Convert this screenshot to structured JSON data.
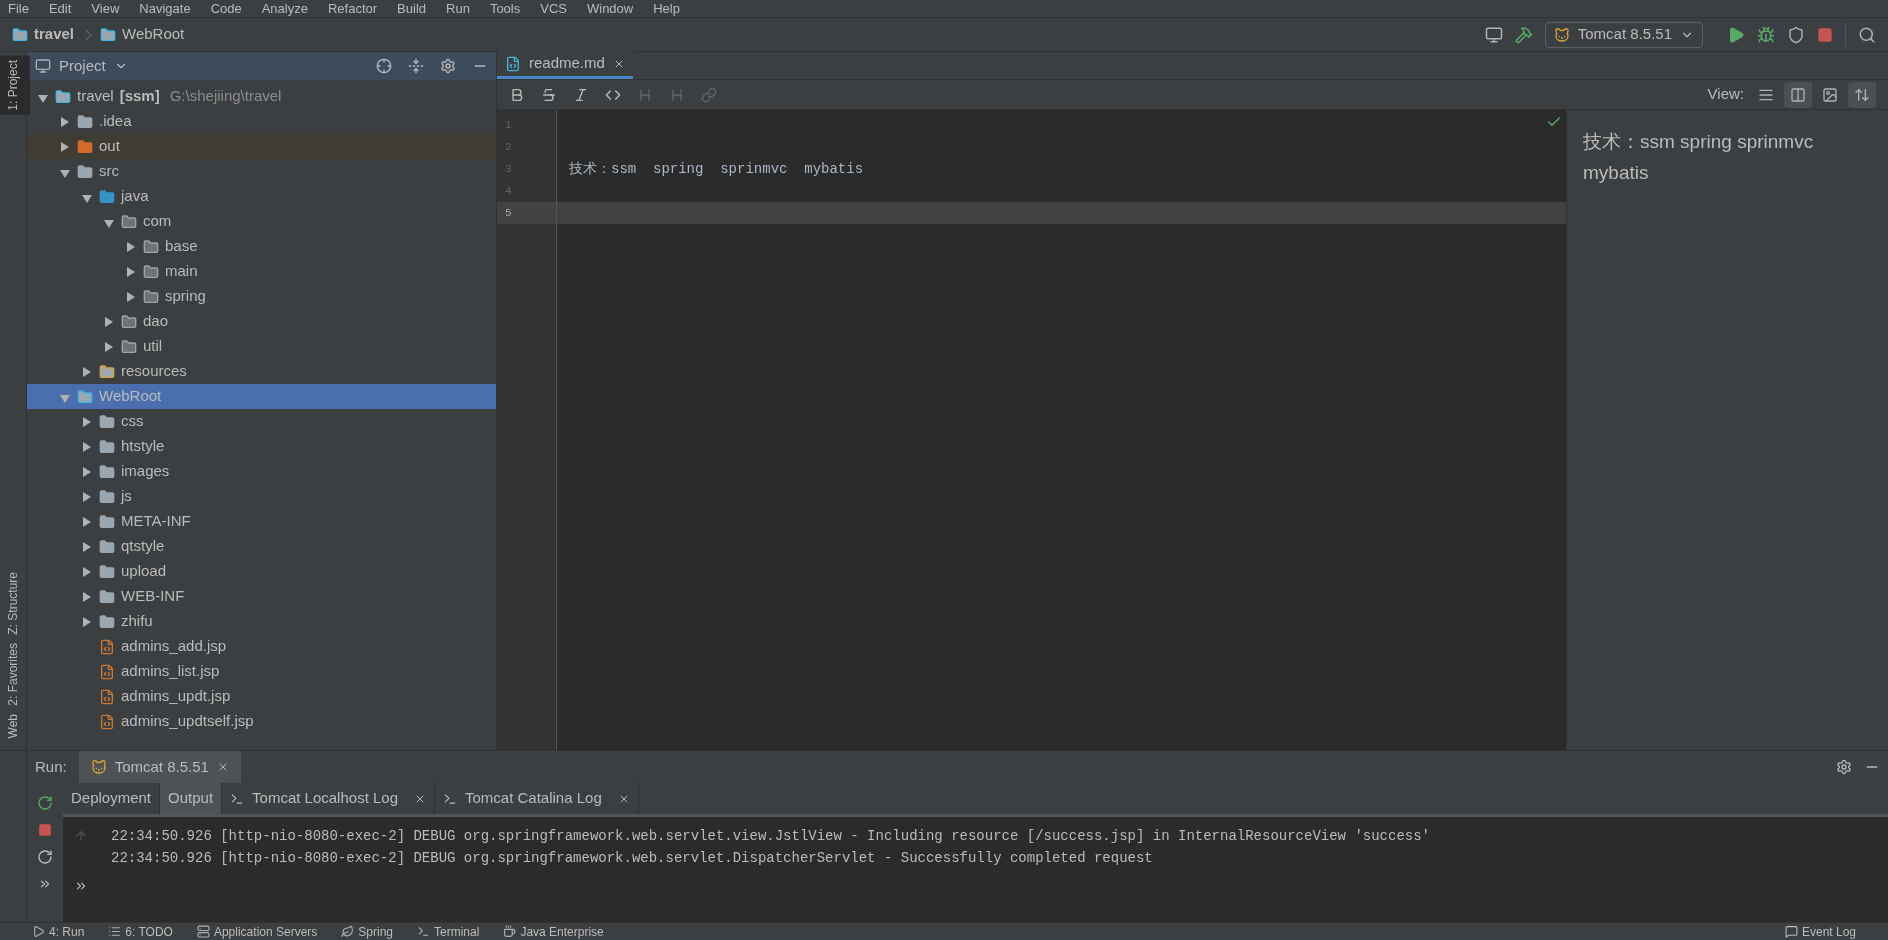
{
  "menu": [
    "File",
    "Edit",
    "View",
    "Navigate",
    "Code",
    "Analyze",
    "Refactor",
    "Build",
    "Run",
    "Tools",
    "VCS",
    "Window",
    "Help"
  ],
  "breadcrumbs": [
    {
      "label": "travel",
      "kind": "project"
    },
    {
      "label": "WebRoot",
      "kind": "web"
    }
  ],
  "run_config": {
    "label": "Tomcat 8.5.51"
  },
  "side_tabs_top": [
    {
      "label": "1: Project",
      "selected": true
    }
  ],
  "side_tabs_bottom": [
    {
      "label": "Z: Structure",
      "selected": false
    },
    {
      "label": "2: Favorites",
      "selected": false
    },
    {
      "label": "Web",
      "selected": false
    }
  ],
  "project_panel": {
    "title": "Project"
  },
  "tree": [
    {
      "name": "travel",
      "tag": "[ssm]",
      "path": "G:\\shejiing\\travel",
      "kind": "module",
      "expanded": true,
      "selected": false,
      "children": [
        {
          "name": ".idea",
          "kind": "folder",
          "expanded": false,
          "selected": false
        },
        {
          "name": "out",
          "kind": "excluded",
          "expanded": false,
          "selected": false
        },
        {
          "name": "src",
          "kind": "folder",
          "expanded": true,
          "selected": false,
          "children": [
            {
              "name": "java",
              "kind": "source",
              "expanded": true,
              "selected": false,
              "children": [
                {
                  "name": "com",
                  "kind": "package",
                  "expanded": true,
                  "selected": false,
                  "children": [
                    {
                      "name": "base",
                      "kind": "package",
                      "expanded": false,
                      "selected": false
                    },
                    {
                      "name": "main",
                      "kind": "package",
                      "expanded": false,
                      "selected": false
                    },
                    {
                      "name": "spring",
                      "kind": "package",
                      "expanded": false,
                      "selected": false
                    }
                  ]
                },
                {
                  "name": "dao",
                  "kind": "package",
                  "expanded": false,
                  "selected": false
                },
                {
                  "name": "util",
                  "kind": "package",
                  "expanded": false,
                  "selected": false
                }
              ]
            },
            {
              "name": "resources",
              "kind": "resources",
              "expanded": false,
              "selected": false
            }
          ]
        },
        {
          "name": "WebRoot",
          "kind": "web",
          "expanded": true,
          "selected": true,
          "children": [
            {
              "name": "css",
              "kind": "folder",
              "expanded": false,
              "selected": false
            },
            {
              "name": "htstyle",
              "kind": "folder",
              "expanded": false,
              "selected": false
            },
            {
              "name": "images",
              "kind": "folder",
              "expanded": false,
              "selected": false
            },
            {
              "name": "js",
              "kind": "folder",
              "expanded": false,
              "selected": false
            },
            {
              "name": "META-INF",
              "kind": "folder",
              "expanded": false,
              "selected": false
            },
            {
              "name": "qtstyle",
              "kind": "folder",
              "expanded": false,
              "selected": false
            },
            {
              "name": "upload",
              "kind": "folder",
              "expanded": false,
              "selected": false
            },
            {
              "name": "WEB-INF",
              "kind": "folder",
              "expanded": false,
              "selected": false
            },
            {
              "name": "zhifu",
              "kind": "folder",
              "expanded": false,
              "selected": false
            },
            {
              "name": "admins_add.jsp",
              "kind": "jsp",
              "selected": false
            },
            {
              "name": "admins_list.jsp",
              "kind": "jsp",
              "selected": false
            },
            {
              "name": "admins_updt.jsp",
              "kind": "jsp",
              "selected": false
            },
            {
              "name": "admins_updtself.jsp",
              "kind": "jsp",
              "selected": false
            }
          ]
        }
      ]
    }
  ],
  "editor": {
    "tab": "readme.md",
    "view_label": "View:",
    "view_modes": [
      {
        "kind": "editor",
        "selected": false
      },
      {
        "kind": "split",
        "selected": true
      },
      {
        "kind": "preview",
        "selected": false
      },
      {
        "kind": "sync",
        "selected": true
      }
    ],
    "lines": [
      {
        "number": "1",
        "current": false
      },
      {
        "number": "2",
        "current": false
      },
      {
        "number": "3",
        "text": "技术：ssm  spring  sprinmvc  mybatis",
        "current": false
      },
      {
        "number": "4",
        "current": false
      },
      {
        "number": "5",
        "current": true
      }
    ],
    "preview": "技术：ssm spring sprinmvc mybatis"
  },
  "run_panel": {
    "label": "Run:",
    "tab": "Tomcat 8.5.51",
    "subtabs": [
      {
        "label": "Deployment",
        "selected": false,
        "closable": false,
        "log": false
      },
      {
        "label": "Output",
        "selected": true,
        "closable": false,
        "log": false
      },
      {
        "label": "Tomcat Localhost Log",
        "selected": false,
        "closable": true,
        "log": true
      },
      {
        "label": "Tomcat Catalina Log",
        "selected": false,
        "closable": true,
        "log": true
      }
    ],
    "console": [
      "22:34:50.926 [http-nio-8080-exec-2] DEBUG org.springframework.web.servlet.view.JstlView - Including resource [/success.jsp] in InternalResourceView 'success'",
      "22:34:50.926 [http-nio-8080-exec-2] DEBUG org.springframework.web.servlet.DispatcherServlet - Successfully completed request"
    ]
  },
  "tool_windows": [
    "4: Run",
    "6: TODO",
    "Application Servers",
    "Spring",
    "Terminal",
    "Java Enterprise"
  ],
  "event_log": "Event Log"
}
